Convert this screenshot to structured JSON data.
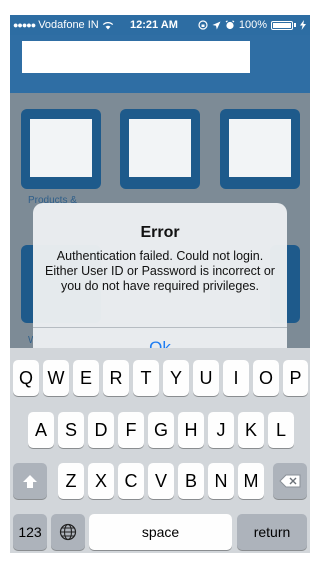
{
  "status_bar": {
    "signal_dots": "●●●●●",
    "carrier": "Vodafone IN",
    "wifi": "wifi-icon",
    "time": "12:21 AM",
    "battery_percent": "100%"
  },
  "home": {
    "tiles": [
      {
        "label": "Products &"
      },
      {
        "label": ""
      },
      {
        "label": ""
      },
      {
        "label": "W"
      }
    ]
  },
  "alert": {
    "title": "Error",
    "message": "Authentication failed. Could not login. Either User ID or Password is incorrect or you do not have required privileges.",
    "ok_label": "Ok"
  },
  "keyboard": {
    "row1": [
      "Q",
      "W",
      "E",
      "R",
      "T",
      "Y",
      "U",
      "I",
      "O",
      "P"
    ],
    "row2": [
      "A",
      "S",
      "D",
      "F",
      "G",
      "H",
      "J",
      "K",
      "L"
    ],
    "row3": [
      "Z",
      "X",
      "C",
      "V",
      "B",
      "N",
      "M"
    ],
    "numbers_label": "123",
    "space_label": "space",
    "return_label": "return"
  }
}
